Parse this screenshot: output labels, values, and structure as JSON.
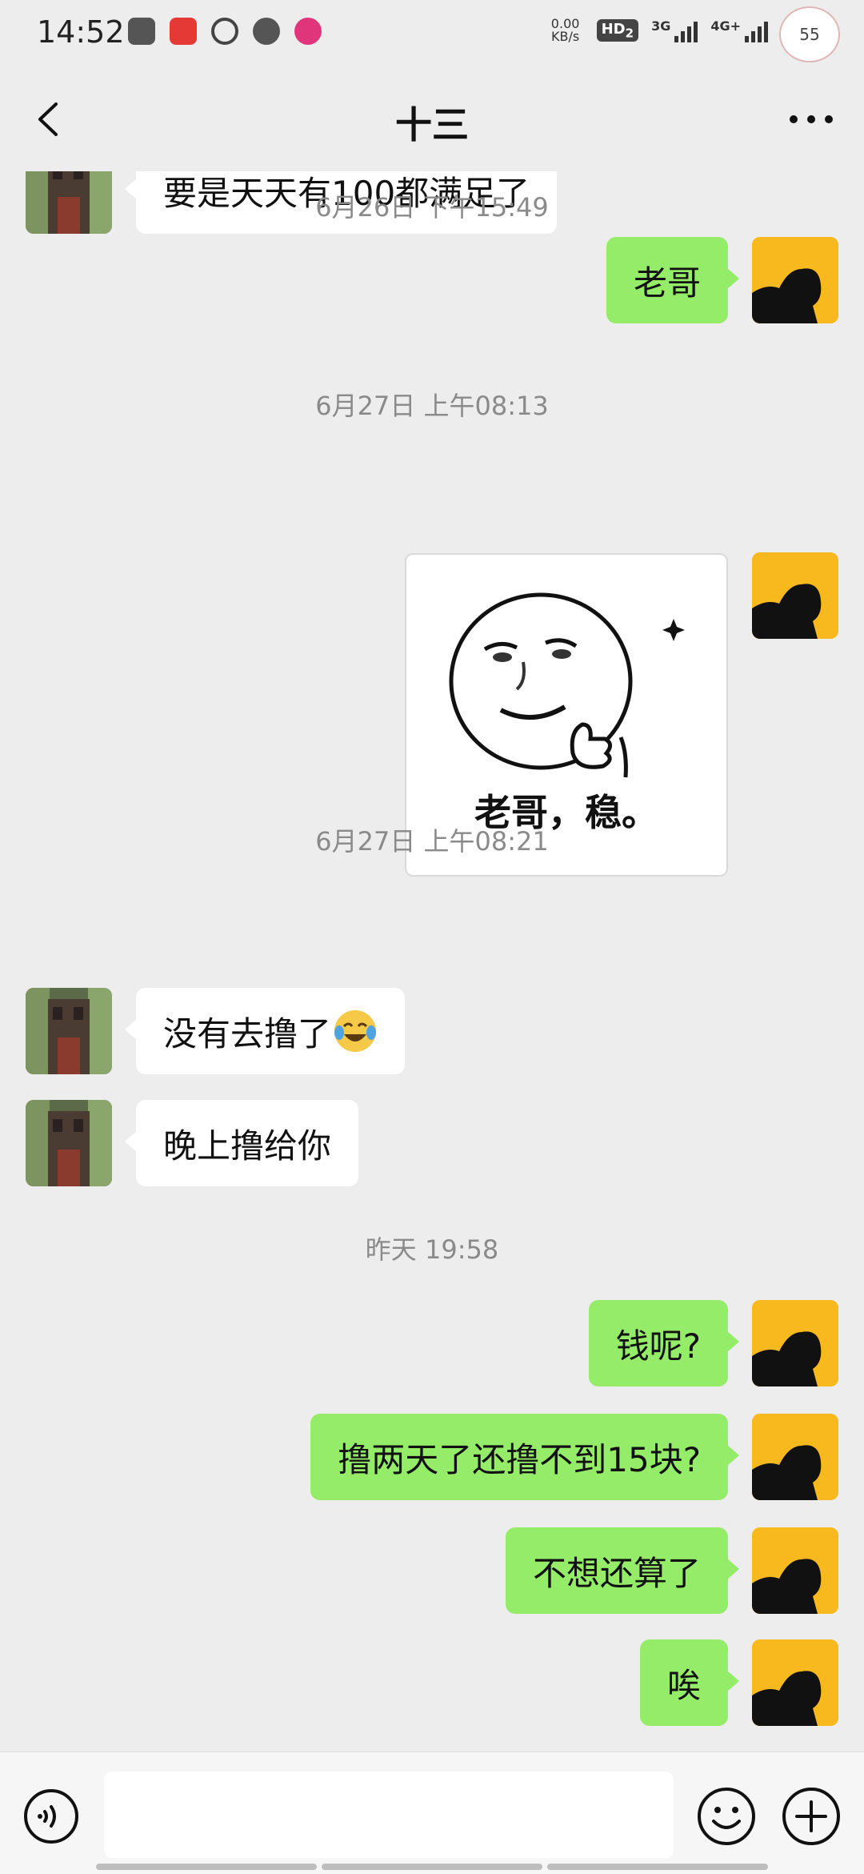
{
  "status_bar": {
    "time": "14:52",
    "net_speed_value": "0.00",
    "net_speed_unit": "KB/s",
    "hd_label": "HD",
    "hd_sub": "2",
    "signal_1_label": "3G",
    "signal_2_label": "4G+",
    "battery_level": "55"
  },
  "nav": {
    "title": "十三"
  },
  "messages": {
    "m1": {
      "text": "要是天天有100都满足了"
    },
    "ts1": "6月26日 下午15:49",
    "m2": {
      "text": "老哥"
    },
    "ts2": "6月27日 上午08:13",
    "sticker_caption": "老哥，稳。",
    "ts3": "6月27日 上午08:21",
    "m4": {
      "text": "没有去撸了"
    },
    "m5": {
      "text": "晚上撸给你"
    },
    "ts4": "昨天 19:58",
    "m6": {
      "text": "钱呢?"
    },
    "m7": {
      "text": "撸两天了还撸不到15块?"
    },
    "m8": {
      "text": "不想还算了"
    },
    "m9": {
      "text": "唉"
    }
  },
  "input_bar": {
    "value": "",
    "placeholder": ""
  },
  "colors": {
    "background": "#ededed",
    "outgoing_bubble": "#95ec69",
    "incoming_bubble": "#ffffff",
    "my_avatar": "#f9c623"
  }
}
